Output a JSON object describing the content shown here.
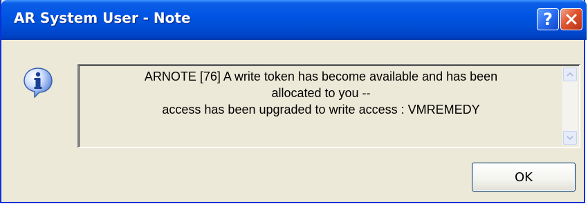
{
  "window": {
    "title": "AR System User - Note",
    "help_label": "?",
    "close_label": "✕"
  },
  "icon": {
    "name": "info-icon",
    "glyph": "i"
  },
  "message": {
    "lines": [
      "ARNOTE [76] A write token has become available and has been",
      "allocated to you --",
      "access has been upgraded to write access : VMREMEDY"
    ]
  },
  "buttons": {
    "ok_label": "OK"
  },
  "colors": {
    "titlebar": "#0054e3",
    "dialog_bg": "#ece9d8",
    "close_red": "#e0542e"
  }
}
